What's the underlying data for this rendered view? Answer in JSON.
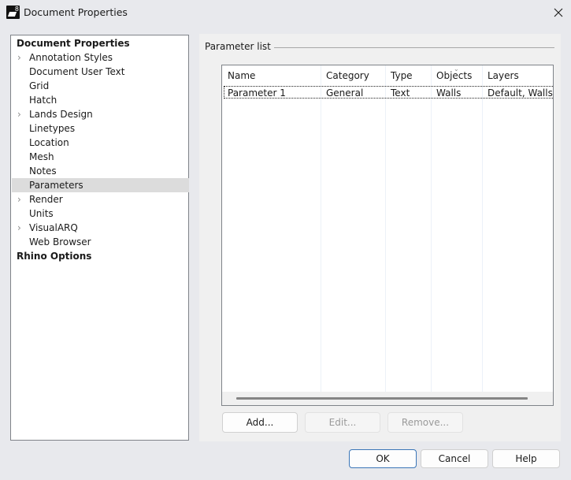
{
  "window": {
    "title": "Document Properties",
    "icon": "rhino-app-icon",
    "icon_badge": "8",
    "close_icon": "close-icon"
  },
  "tree": {
    "items": [
      {
        "label": "Document Properties",
        "level": 0,
        "bold": true,
        "expandable": false,
        "selected": false
      },
      {
        "label": "Annotation Styles",
        "level": 1,
        "expandable": true,
        "selected": false
      },
      {
        "label": "Document User Text",
        "level": 1,
        "expandable": false,
        "selected": false
      },
      {
        "label": "Grid",
        "level": 1,
        "expandable": false,
        "selected": false
      },
      {
        "label": "Hatch",
        "level": 1,
        "expandable": false,
        "selected": false
      },
      {
        "label": "Lands Design",
        "level": 1,
        "expandable": true,
        "selected": false
      },
      {
        "label": "Linetypes",
        "level": 1,
        "expandable": false,
        "selected": false
      },
      {
        "label": "Location",
        "level": 1,
        "expandable": false,
        "selected": false
      },
      {
        "label": "Mesh",
        "level": 1,
        "expandable": false,
        "selected": false
      },
      {
        "label": "Notes",
        "level": 1,
        "expandable": false,
        "selected": false
      },
      {
        "label": "Parameters",
        "level": 1,
        "expandable": false,
        "selected": true
      },
      {
        "label": "Render",
        "level": 1,
        "expandable": true,
        "selected": false
      },
      {
        "label": "Units",
        "level": 1,
        "expandable": false,
        "selected": false
      },
      {
        "label": "VisualARQ",
        "level": 1,
        "expandable": true,
        "selected": false
      },
      {
        "label": "Web Browser",
        "level": 1,
        "expandable": false,
        "selected": false
      },
      {
        "label": "Rhino Options",
        "level": 0,
        "bold": true,
        "expandable": false,
        "selected": false
      }
    ],
    "chevron_glyph": "›"
  },
  "parameters": {
    "group_label": "Parameter list",
    "columns": [
      "Name",
      "Category",
      "Type",
      "Objects",
      "Layers"
    ],
    "sort_indicator": "⌄",
    "rows": [
      {
        "name": "Parameter 1",
        "category": "General",
        "type": "Text",
        "objects": "Walls",
        "layers": "Default, Walls"
      }
    ],
    "buttons": {
      "add": "Add...",
      "edit": "Edit...",
      "remove": "Remove..."
    }
  },
  "footer": {
    "ok": "OK",
    "cancel": "Cancel",
    "help": "Help"
  }
}
